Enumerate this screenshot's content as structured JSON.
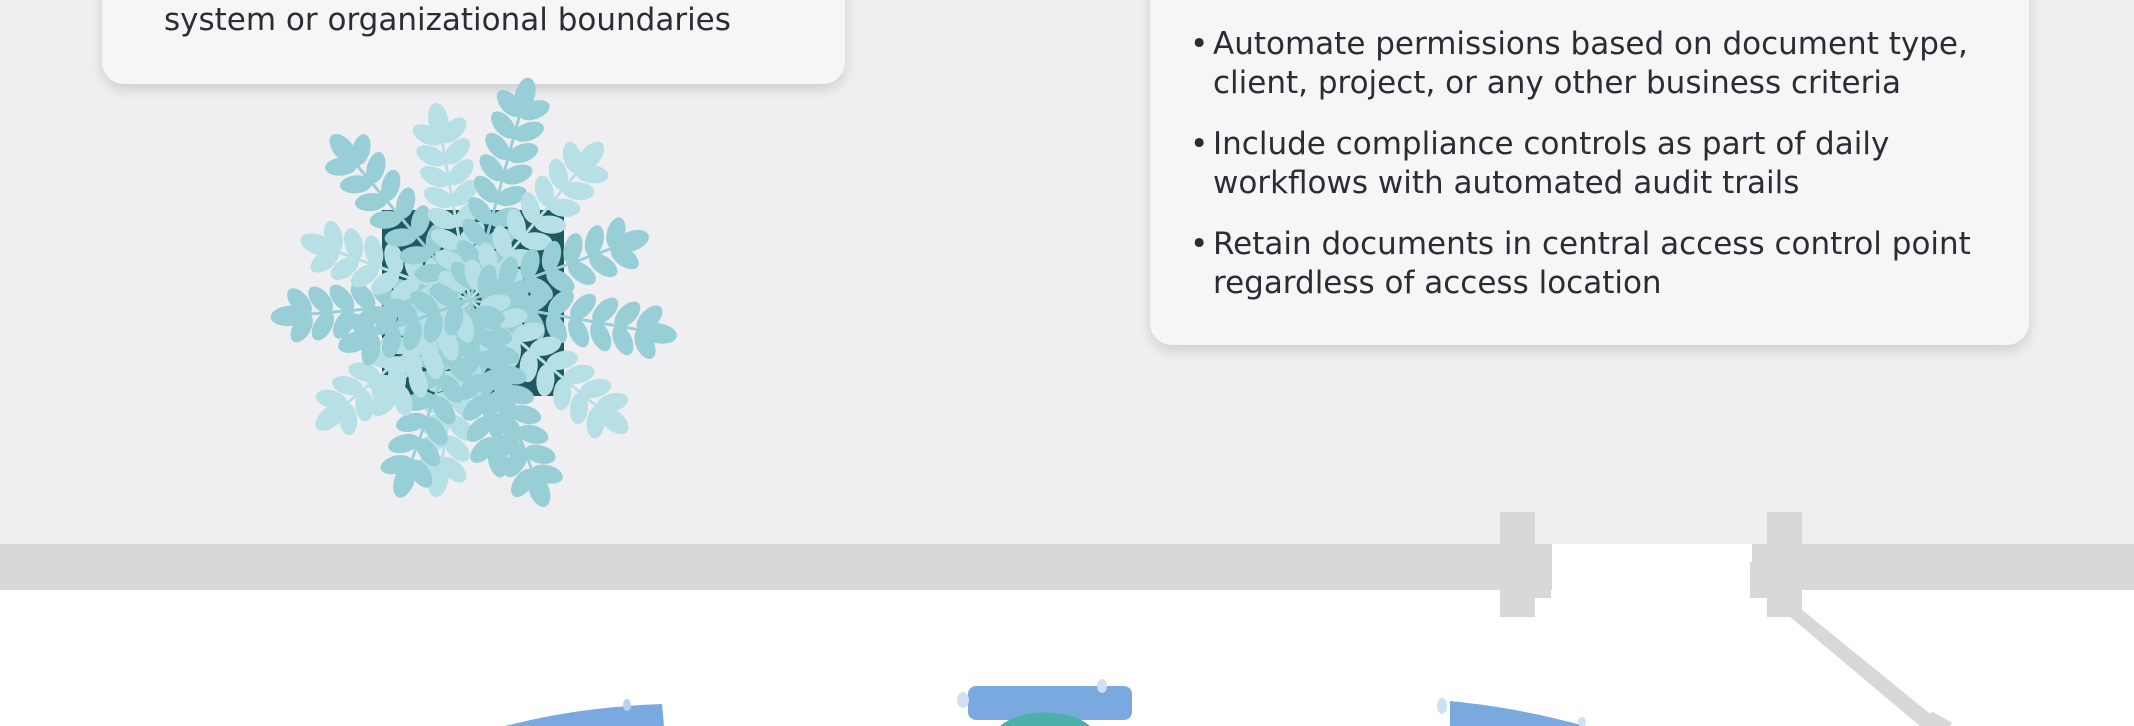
{
  "left_card": {
    "text": "system or organizational boundaries"
  },
  "right_card": {
    "items": [
      {
        "line1": "Automate permissions based on document type,",
        "line2": "client, project, or any other business criteria"
      },
      {
        "line1": "Include compliance controls as part of daily",
        "line2": "workflows with automated audit trails"
      },
      {
        "line1": "Retain documents in central access control point",
        "line2": "regardless of access location"
      }
    ],
    "bullet": "•"
  },
  "colors": {
    "background": "#efeff1",
    "card": "#f6f6f7",
    "text": "#2c2c34",
    "leaf_light": "#b7e0e6",
    "leaf_dark": "#98cfd7",
    "pot": "#1f5960",
    "wall": "#d8d8d8",
    "floor": "#ffffff",
    "chair_blue": "#7aa9e0",
    "chair_teal": "#4ab0a8"
  }
}
